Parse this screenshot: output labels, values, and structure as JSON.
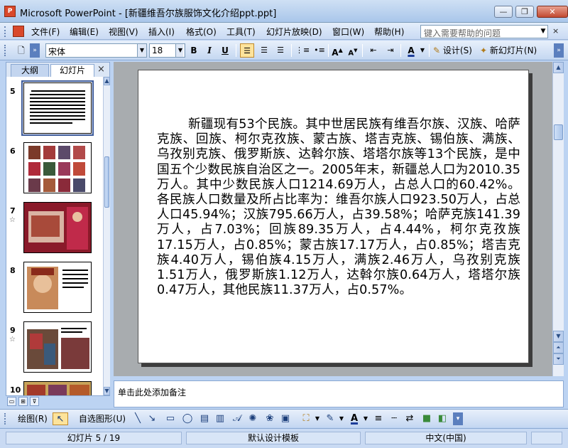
{
  "window": {
    "title": "Microsoft PowerPoint - [新疆维吾尔族服饰文化介绍ppt.ppt]",
    "minimize": "—",
    "restore": "❐",
    "close": "✕"
  },
  "menu": {
    "items": [
      "文件(F)",
      "编辑(E)",
      "视图(V)",
      "插入(I)",
      "格式(O)",
      "工具(T)",
      "幻灯片放映(D)",
      "窗口(W)",
      "帮助(H)"
    ],
    "help_placeholder": "键入需要帮助的问题"
  },
  "toolbar": {
    "font_name": "宋体",
    "font_size": "18",
    "bold": "B",
    "italic": "I",
    "underline": "U",
    "design_label": "设计(S)",
    "new_slide_label": "新幻灯片(N)"
  },
  "left_pane": {
    "tab_outline": "大纲",
    "tab_slides": "幻灯片",
    "close": "×",
    "thumbnails": [
      {
        "num": "5",
        "selected": true,
        "star": false
      },
      {
        "num": "6",
        "selected": false,
        "star": false
      },
      {
        "num": "7",
        "selected": false,
        "star": true
      },
      {
        "num": "8",
        "selected": false,
        "star": false
      },
      {
        "num": "9",
        "selected": false,
        "star": true
      },
      {
        "num": "10",
        "selected": false,
        "star": false
      }
    ]
  },
  "slide": {
    "body": "新疆现有53个民族。其中世居民族有维吾尔族、汉族、哈萨克族、回族、柯尔克孜族、蒙古族、塔吉克族、锡伯族、满族、乌孜别克族、俄罗斯族、达斡尔族、塔塔尔族等13个民族，是中国五个少数民族自治区之一。2005年末，新疆总人口为2010.35万人。其中少数民族人口1214.69万人，占总人口的60.42%。各民族人口数量及所占比率为：维吾尔族人口923.50万人，占总人口45.94%；汉族795.66万人，占39.58%；哈萨克族141.39万人，占7.03%；回族89.35万人，占4.44%，柯尔克孜族17.15万人，占0.85%；蒙古族17.17万人，占0.85%；塔吉克族4.40万人，锡伯族4.15万人，满族2.46万人，乌孜别克族1.51万人，俄罗斯族1.12万人，达斡尔族0.64万人，塔塔尔族0.47万人，其他民族11.37万人，占0.57%。"
  },
  "notes": {
    "placeholder": "单击此处添加备注"
  },
  "drawing": {
    "draw_label": "绘图(R)",
    "autoshapes_label": "自选图形(U)"
  },
  "status": {
    "slide_info": "幻灯片 5 / 19",
    "template": "默认设计模板",
    "language": "中文(中国)"
  },
  "colors": {
    "accent": "#3c5a9a",
    "title_bar": "#a9c6ea",
    "edit_bg": "#a8acaf"
  }
}
